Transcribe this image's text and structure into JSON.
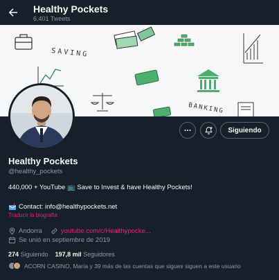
{
  "header": {
    "title": "Healthy Pockets",
    "subtitle": "6.401 Tweets"
  },
  "banner": {
    "words": [
      "SAVING",
      "BANKING"
    ]
  },
  "actions": {
    "follow_label": "Siguiendo"
  },
  "profile": {
    "name": "Healthy Pockets",
    "handle": "@healthy_pockets",
    "bio_line1": "440,000 + YouTube 📺 Save to Invest & have Healthy Pockets!",
    "bio_line2": "Contact: info@healthypockets.net",
    "translate": "Traducir la biografía",
    "location": "Andorra",
    "website": "youtube.com/c/Healthypocke...",
    "joined": "Se unió en septiembre de 2019"
  },
  "stats": {
    "following_count": "274",
    "following_label": "Siguiendo",
    "followers_count": "197,8 mil",
    "followers_label": "Seguidores"
  },
  "known_followers": "ACORN CASINO, María y 39 más de las cuentas que sigues siguen a este usuario",
  "colors": {
    "background": "#15202b",
    "accent_link": "#f91880",
    "muted": "#8b98a5"
  }
}
